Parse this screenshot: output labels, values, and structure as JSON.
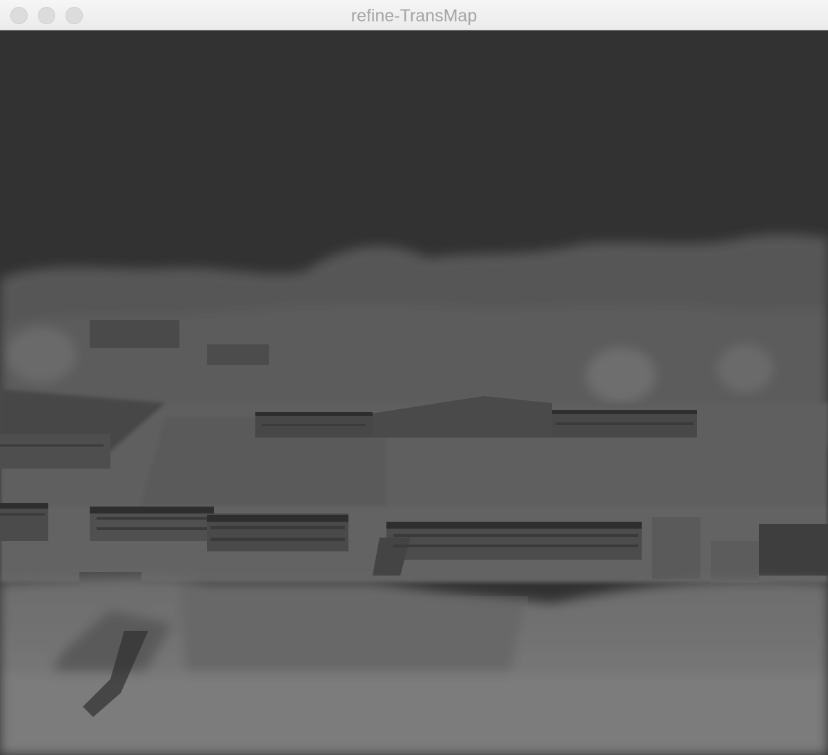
{
  "window": {
    "title": "refine-TransMap",
    "controls": {
      "close_icon": "close-icon",
      "minimize_icon": "minimize-icon",
      "zoom_icon": "zoom-icon"
    }
  },
  "image_view": {
    "description_icon": "grayscale-transmission-map",
    "colors": {
      "sky": "#323232",
      "haze": "#5a5a5a",
      "ground": "#7a7a7a",
      "buildings": "#4a4a4a"
    }
  }
}
